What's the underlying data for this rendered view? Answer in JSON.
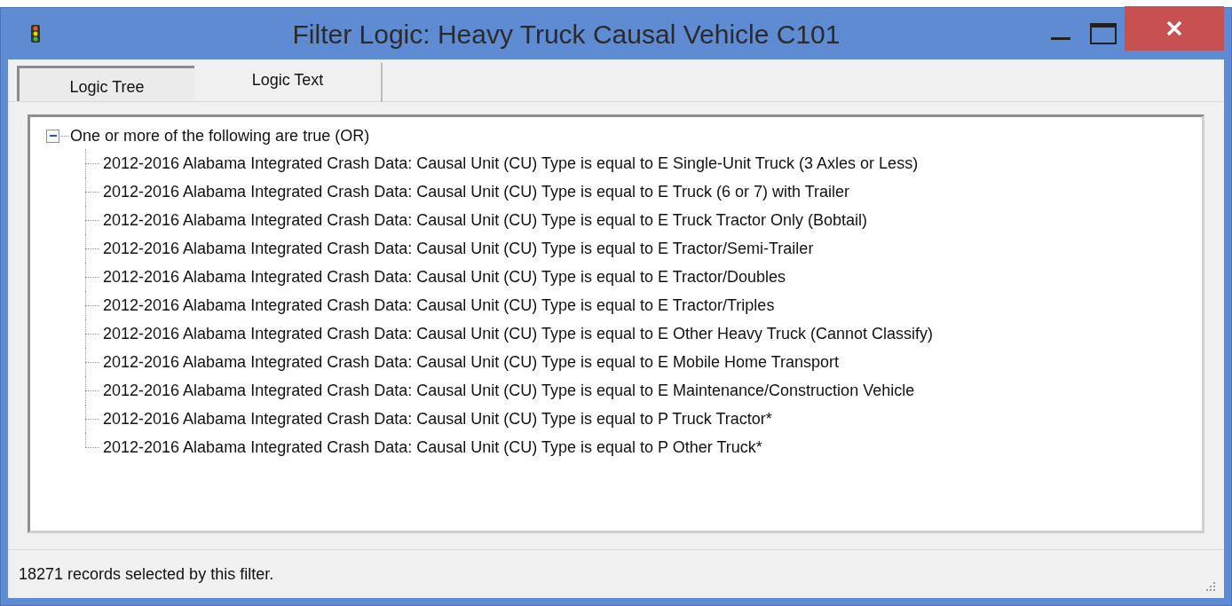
{
  "window": {
    "title": "Filter Logic: Heavy Truck Causal Vehicle C101"
  },
  "tabs": [
    {
      "label": "Logic Tree",
      "selected": true
    },
    {
      "label": "Logic Text",
      "selected": false
    }
  ],
  "tree": {
    "label": "One or more of the following are true (OR)",
    "expanded": true,
    "children": [
      {
        "label": "2012-2016 Alabama Integrated Crash Data: Causal Unit (CU) Type is equal to E Single-Unit Truck (3 Axles or Less)"
      },
      {
        "label": "2012-2016 Alabama Integrated Crash Data: Causal Unit (CU) Type is equal to E Truck (6 or 7) with Trailer"
      },
      {
        "label": "2012-2016 Alabama Integrated Crash Data: Causal Unit (CU) Type is equal to E Truck Tractor Only (Bobtail)"
      },
      {
        "label": "2012-2016 Alabama Integrated Crash Data: Causal Unit (CU) Type is equal to E Tractor/Semi-Trailer"
      },
      {
        "label": "2012-2016 Alabama Integrated Crash Data: Causal Unit (CU) Type is equal to E Tractor/Doubles"
      },
      {
        "label": "2012-2016 Alabama Integrated Crash Data: Causal Unit (CU) Type is equal to E Tractor/Triples"
      },
      {
        "label": "2012-2016 Alabama Integrated Crash Data: Causal Unit (CU) Type is equal to E Other Heavy Truck (Cannot Classify)"
      },
      {
        "label": "2012-2016 Alabama Integrated Crash Data: Causal Unit (CU) Type is equal to E Mobile Home Transport"
      },
      {
        "label": "2012-2016 Alabama Integrated Crash Data: Causal Unit (CU) Type is equal to E Maintenance/Construction Vehicle"
      },
      {
        "label": "2012-2016 Alabama Integrated Crash Data: Causal Unit (CU) Type is equal to P Truck Tractor*"
      },
      {
        "label": "2012-2016 Alabama Integrated Crash Data: Causal Unit (CU) Type is equal to P Other Truck*"
      }
    ]
  },
  "status_bar": {
    "text": "18271 records selected by this filter."
  }
}
